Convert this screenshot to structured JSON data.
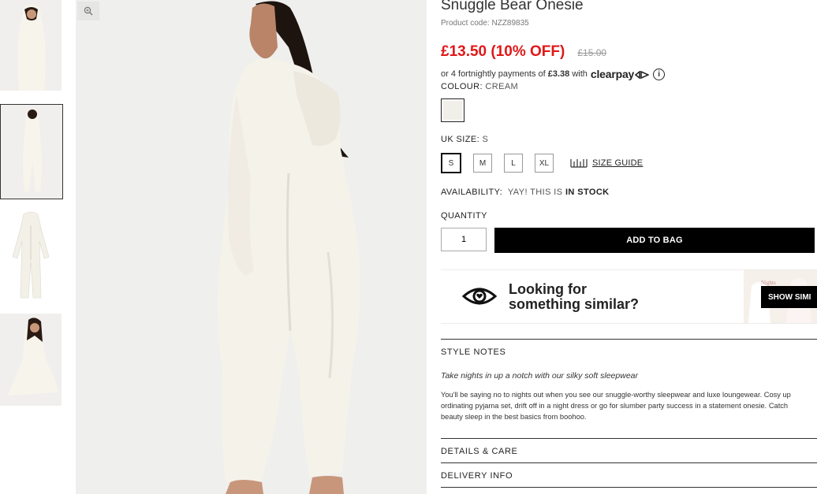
{
  "product": {
    "title": "Snuggle Bear Onesie",
    "code": "Product code: NZZ89835",
    "price_now": "£13.50 (10% OFF)",
    "price_was": "£15.00"
  },
  "clearpay": {
    "prefix": "or 4 fortnightly payments of",
    "amount": "£3.38",
    "with": "with",
    "logo": "clearpay",
    "info_icon": "info-icon"
  },
  "colour": {
    "label": "COLOUR:",
    "value": "CREAM",
    "swatch_color": "#f1efe9"
  },
  "size": {
    "label": "UK SIZE:",
    "value": "S",
    "options": [
      "S",
      "M",
      "L",
      "XL"
    ],
    "selected": "S",
    "guide": "SIZE GUIDE"
  },
  "availability": {
    "label": "AVAILABILITY:",
    "prefix": "YAY! THIS IS",
    "status": "IN STOCK"
  },
  "quantity": {
    "label": "QUANTITY",
    "value": "1"
  },
  "add_to_bag": "ADD TO BAG",
  "similar": {
    "line1": "Looking for",
    "line2": "something similar?",
    "button": "SHOW SIMI"
  },
  "style_notes": {
    "heading": "STYLE NOTES",
    "subtitle": "Take nights in up a notch with our silky soft sleepwear",
    "body_lines": [
      "You'll be saying no to nights out when you see our snuggle-worthy sleepwear and luxe loungewear. Cosy up",
      "ordinating pyjama set, drift off in a night dress or go for slumber party success in a statement onesie. Catch",
      "beauty sleep in the best basics from boohoo."
    ]
  },
  "details_heading": "DETAILS & CARE",
  "delivery_heading": "DELIVERY INFO",
  "colors": {
    "sale_red": "#e01818",
    "black": "#000000",
    "cream": "#f1efe9"
  }
}
